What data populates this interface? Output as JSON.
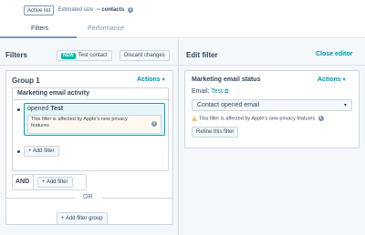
{
  "topbar": {
    "list_badge": "Active list",
    "estimated_label": "Estimated size:",
    "estimated_value": "-- contacts",
    "info_glyph": "i"
  },
  "tabs": [
    {
      "label": "Filters",
      "active": true
    },
    {
      "label": "Performance",
      "active": false
    }
  ],
  "filters_panel": {
    "title": "Filters",
    "new_badge": "NEW",
    "test_contact_label": "Test contact",
    "discard_label": "Discard changes",
    "group": {
      "title": "Group 1",
      "actions_label": "Actions",
      "activity_title": "Marketing email activity",
      "condition_prefix": "opened",
      "condition_value": "Test",
      "privacy_note": "This filter is affected by Apple's new privacy features",
      "add_filter_label": "+ Add filter",
      "and_label": "AND",
      "and_add_filter_label": "+ Add filter"
    },
    "or_label": "OR",
    "add_group_label": "+ Add filter group"
  },
  "edit_panel": {
    "title": "Edit filter",
    "close_label": "Close editor",
    "status_title": "Marketing email status",
    "actions_label": "Actions",
    "email_label": "Email:",
    "email_value": "Test",
    "select_value": "Contact opened email",
    "privacy_note": "This filter is affected by Apple's new privacy features",
    "refine_label": "Refine this filter"
  },
  "colors": {
    "link": "#0091ae",
    "new_badge": "#00bda5",
    "selected_border": "#00a4bd",
    "selected_bg": "#e5f5f8",
    "warning": "#f5c26b"
  }
}
